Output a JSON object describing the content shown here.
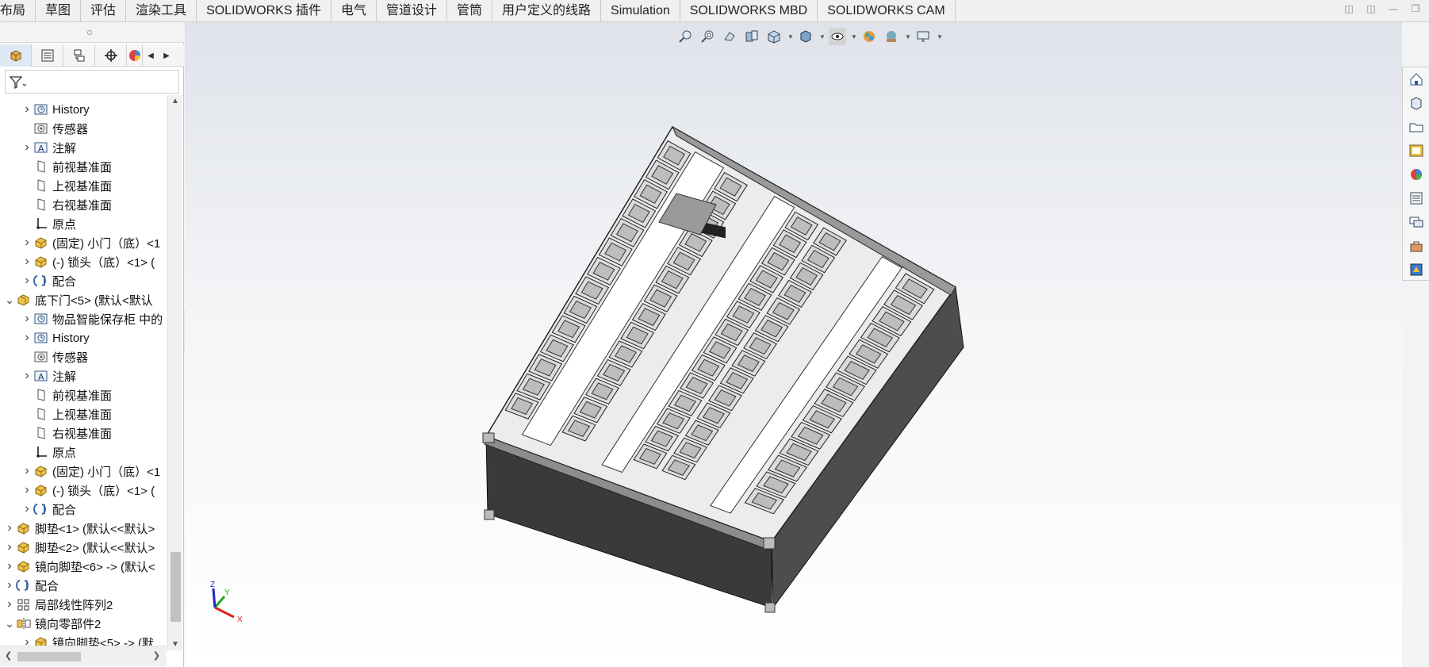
{
  "tabs": [
    "布局",
    "草图",
    "评估",
    "渲染工具",
    "SOLIDWORKS 插件",
    "电气",
    "管道设计",
    "管筒",
    "用户定义的线路",
    "Simulation",
    "SOLIDWORKS MBD",
    "SOLIDWORKS CAM"
  ],
  "manager_tabs": [
    {
      "name": "featuremanager-tab-icon"
    },
    {
      "name": "propertymanager-tab-icon"
    },
    {
      "name": "configurationmanager-tab-icon"
    },
    {
      "name": "dimxpertmanager-tab-icon"
    },
    {
      "name": "displaymanager-tab-icon"
    }
  ],
  "tree": [
    {
      "label": "History",
      "icon": "history-icon",
      "indent": 2,
      "arrow": "right"
    },
    {
      "label": "传感器",
      "icon": "sensor-icon",
      "indent": 2,
      "arrow": ""
    },
    {
      "label": "注解",
      "icon": "annotation-icon",
      "indent": 2,
      "arrow": "right"
    },
    {
      "label": "前视基准面",
      "icon": "plane-icon",
      "indent": 2,
      "arrow": ""
    },
    {
      "label": "上视基准面",
      "icon": "plane-icon",
      "indent": 2,
      "arrow": ""
    },
    {
      "label": "右视基准面",
      "icon": "plane-icon",
      "indent": 2,
      "arrow": ""
    },
    {
      "label": "原点",
      "icon": "origin-icon",
      "indent": 2,
      "arrow": ""
    },
    {
      "label": "(固定) 小门（底）<1",
      "icon": "part-icon",
      "indent": 2,
      "arrow": "right"
    },
    {
      "label": "(-) 锁头（底）<1> (",
      "icon": "part-icon",
      "indent": 2,
      "arrow": "right"
    },
    {
      "label": "配合",
      "icon": "mate-icon",
      "indent": 2,
      "arrow": "right"
    },
    {
      "label": "底下门<5> (默认<默认",
      "icon": "assembly-icon",
      "indent": 1,
      "arrow": "down"
    },
    {
      "label": "物品智能保存柜 中的",
      "icon": "history-icon",
      "indent": 2,
      "arrow": "right"
    },
    {
      "label": "History",
      "icon": "history-icon",
      "indent": 2,
      "arrow": "right"
    },
    {
      "label": "传感器",
      "icon": "sensor-icon",
      "indent": 2,
      "arrow": ""
    },
    {
      "label": "注解",
      "icon": "annotation-icon",
      "indent": 2,
      "arrow": "right"
    },
    {
      "label": "前视基准面",
      "icon": "plane-icon",
      "indent": 2,
      "arrow": ""
    },
    {
      "label": "上视基准面",
      "icon": "plane-icon",
      "indent": 2,
      "arrow": ""
    },
    {
      "label": "右视基准面",
      "icon": "plane-icon",
      "indent": 2,
      "arrow": ""
    },
    {
      "label": "原点",
      "icon": "origin-icon",
      "indent": 2,
      "arrow": ""
    },
    {
      "label": "(固定) 小门（底）<1",
      "icon": "part-icon",
      "indent": 2,
      "arrow": "right"
    },
    {
      "label": "(-) 锁头（底）<1> (",
      "icon": "part-icon",
      "indent": 2,
      "arrow": "right"
    },
    {
      "label": "配合",
      "icon": "mate-icon",
      "indent": 2,
      "arrow": "right"
    },
    {
      "label": "脚垫<1> (默认<<默认>",
      "icon": "part-icon",
      "indent": 1,
      "arrow": "right"
    },
    {
      "label": "脚垫<2> (默认<<默认>",
      "icon": "part-icon",
      "indent": 1,
      "arrow": "right"
    },
    {
      "label": "镜向脚垫<6> -> (默认<",
      "icon": "part-icon",
      "indent": 1,
      "arrow": "right"
    },
    {
      "label": "配合",
      "icon": "mate-icon",
      "indent": 1,
      "arrow": "right"
    },
    {
      "label": "局部线性阵列2",
      "icon": "pattern-icon",
      "indent": 1,
      "arrow": "right"
    },
    {
      "label": "镜向零部件2",
      "icon": "mirror-icon",
      "indent": 1,
      "arrow": "down"
    },
    {
      "label": "镜向脚垫<5> -> (默",
      "icon": "part-icon",
      "indent": 2,
      "arrow": "right"
    }
  ],
  "heads_up_tools": [
    "zoom-to-fit-icon",
    "zoom-to-area-icon",
    "previous-view-icon",
    "section-view-icon",
    "view-orientation-icon",
    "display-style-icon",
    "hide-show-items-icon",
    "edit-appearance-icon",
    "apply-scene-icon",
    "view-settings-icon"
  ],
  "task_pane": [
    "home-icon",
    "design-library-icon",
    "file-explorer-icon",
    "view-palette-icon",
    "appearances-icon",
    "custom-properties-icon",
    "forum-icon",
    "toolbox-icon",
    "3d-content-icon"
  ],
  "triad": {
    "x": "X",
    "y": "Y",
    "z": "Z"
  }
}
